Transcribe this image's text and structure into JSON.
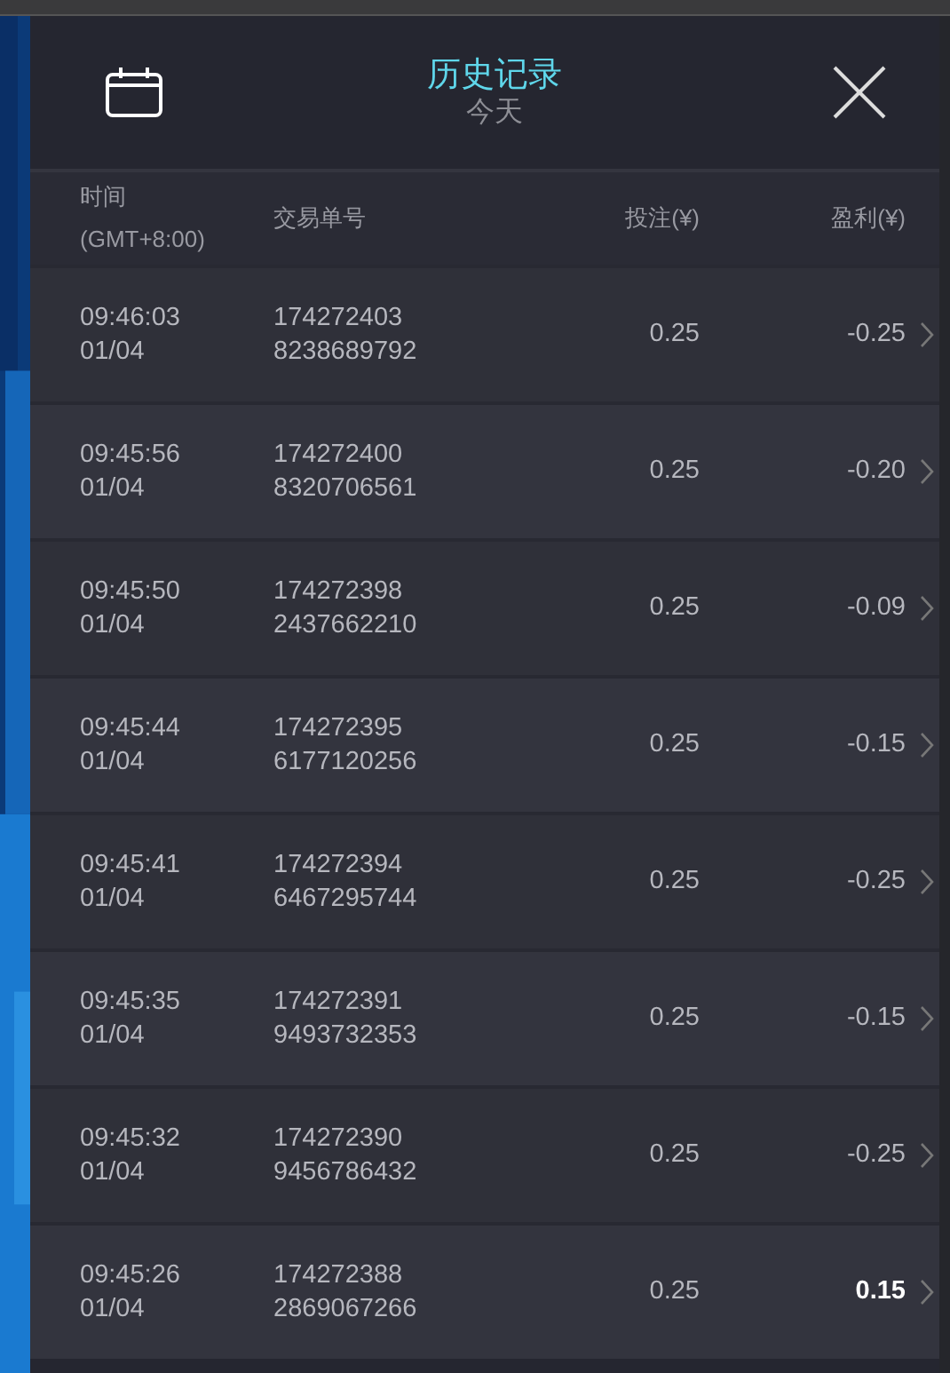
{
  "header": {
    "title": "历史记录",
    "subtitle": "今天"
  },
  "columns": [
    "时间",
    "(GMT+8:00)",
    "交易单号",
    "投注(¥)",
    "盈利(¥)"
  ],
  "rows": [
    {
      "time": "09:46:03",
      "date": "01/04",
      "order_1": "174272403",
      "order_2": "8238689792",
      "bet": "0.25",
      "profit": "-0.25",
      "positive": false
    },
    {
      "time": "09:45:56",
      "date": "01/04",
      "order_1": "174272400",
      "order_2": "8320706561",
      "bet": "0.25",
      "profit": "-0.20",
      "positive": false
    },
    {
      "time": "09:45:50",
      "date": "01/04",
      "order_1": "174272398",
      "order_2": "2437662210",
      "bet": "0.25",
      "profit": "-0.09",
      "positive": false
    },
    {
      "time": "09:45:44",
      "date": "01/04",
      "order_1": "174272395",
      "order_2": "6177120256",
      "bet": "0.25",
      "profit": "-0.15",
      "positive": false
    },
    {
      "time": "09:45:41",
      "date": "01/04",
      "order_1": "174272394",
      "order_2": "6467295744",
      "bet": "0.25",
      "profit": "-0.25",
      "positive": false
    },
    {
      "time": "09:45:35",
      "date": "01/04",
      "order_1": "174272391",
      "order_2": "9493732353",
      "bet": "0.25",
      "profit": "-0.15",
      "positive": false
    },
    {
      "time": "09:45:32",
      "date": "01/04",
      "order_1": "174272390",
      "order_2": "9456786432",
      "bet": "0.25",
      "profit": "-0.25",
      "positive": false
    },
    {
      "time": "09:45:26",
      "date": "01/04",
      "order_1": "174272388",
      "order_2": "2869067266",
      "bet": "0.25",
      "profit": "0.15",
      "positive": true
    }
  ]
}
